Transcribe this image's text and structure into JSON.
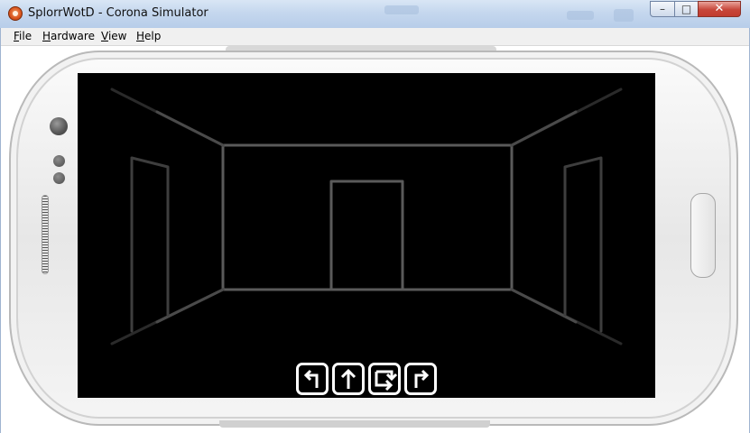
{
  "window": {
    "title": "SplorrWotD - Corona Simulator",
    "icon": "corona-simulator-icon",
    "controls": {
      "minimize": "–",
      "maximize": "□",
      "close": "✕"
    }
  },
  "menubar": {
    "items": [
      {
        "label": "File",
        "access_key": "F"
      },
      {
        "label": "Hardware",
        "access_key": "H"
      },
      {
        "label": "View",
        "access_key": "V"
      },
      {
        "label": "Help",
        "access_key": "H"
      }
    ]
  },
  "device": {
    "buttons": [
      "sensor-icon",
      "home-button"
    ]
  },
  "game": {
    "controls": [
      {
        "name": "turn-left-button",
        "icon": "turn-left-arrow-icon"
      },
      {
        "name": "move-forward-button",
        "icon": "up-arrow-icon"
      },
      {
        "name": "turn-around-button",
        "icon": "u-turn-arrow-icon"
      },
      {
        "name": "turn-right-button",
        "icon": "turn-right-arrow-icon"
      }
    ],
    "colors": {
      "walls": "#5a5a5a",
      "background": "#000000",
      "button_border": "#ffffff"
    }
  }
}
